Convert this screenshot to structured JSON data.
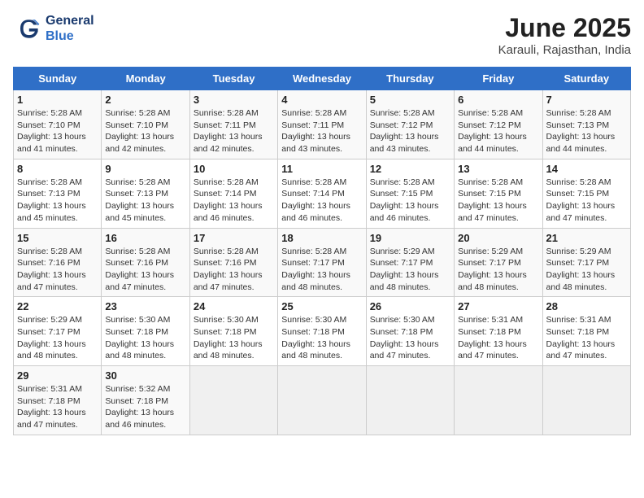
{
  "logo": {
    "line1": "General",
    "line2": "Blue"
  },
  "title": "June 2025",
  "subtitle": "Karauli, Rajasthan, India",
  "days_of_week": [
    "Sunday",
    "Monday",
    "Tuesday",
    "Wednesday",
    "Thursday",
    "Friday",
    "Saturday"
  ],
  "weeks": [
    [
      {
        "day": 1,
        "info": "Sunrise: 5:28 AM\nSunset: 7:10 PM\nDaylight: 13 hours\nand 41 minutes."
      },
      {
        "day": 2,
        "info": "Sunrise: 5:28 AM\nSunset: 7:10 PM\nDaylight: 13 hours\nand 42 minutes."
      },
      {
        "day": 3,
        "info": "Sunrise: 5:28 AM\nSunset: 7:11 PM\nDaylight: 13 hours\nand 42 minutes."
      },
      {
        "day": 4,
        "info": "Sunrise: 5:28 AM\nSunset: 7:11 PM\nDaylight: 13 hours\nand 43 minutes."
      },
      {
        "day": 5,
        "info": "Sunrise: 5:28 AM\nSunset: 7:12 PM\nDaylight: 13 hours\nand 43 minutes."
      },
      {
        "day": 6,
        "info": "Sunrise: 5:28 AM\nSunset: 7:12 PM\nDaylight: 13 hours\nand 44 minutes."
      },
      {
        "day": 7,
        "info": "Sunrise: 5:28 AM\nSunset: 7:13 PM\nDaylight: 13 hours\nand 44 minutes."
      }
    ],
    [
      {
        "day": 8,
        "info": "Sunrise: 5:28 AM\nSunset: 7:13 PM\nDaylight: 13 hours\nand 45 minutes."
      },
      {
        "day": 9,
        "info": "Sunrise: 5:28 AM\nSunset: 7:13 PM\nDaylight: 13 hours\nand 45 minutes."
      },
      {
        "day": 10,
        "info": "Sunrise: 5:28 AM\nSunset: 7:14 PM\nDaylight: 13 hours\nand 46 minutes."
      },
      {
        "day": 11,
        "info": "Sunrise: 5:28 AM\nSunset: 7:14 PM\nDaylight: 13 hours\nand 46 minutes."
      },
      {
        "day": 12,
        "info": "Sunrise: 5:28 AM\nSunset: 7:15 PM\nDaylight: 13 hours\nand 46 minutes."
      },
      {
        "day": 13,
        "info": "Sunrise: 5:28 AM\nSunset: 7:15 PM\nDaylight: 13 hours\nand 47 minutes."
      },
      {
        "day": 14,
        "info": "Sunrise: 5:28 AM\nSunset: 7:15 PM\nDaylight: 13 hours\nand 47 minutes."
      }
    ],
    [
      {
        "day": 15,
        "info": "Sunrise: 5:28 AM\nSunset: 7:16 PM\nDaylight: 13 hours\nand 47 minutes."
      },
      {
        "day": 16,
        "info": "Sunrise: 5:28 AM\nSunset: 7:16 PM\nDaylight: 13 hours\nand 47 minutes."
      },
      {
        "day": 17,
        "info": "Sunrise: 5:28 AM\nSunset: 7:16 PM\nDaylight: 13 hours\nand 47 minutes."
      },
      {
        "day": 18,
        "info": "Sunrise: 5:28 AM\nSunset: 7:17 PM\nDaylight: 13 hours\nand 48 minutes."
      },
      {
        "day": 19,
        "info": "Sunrise: 5:29 AM\nSunset: 7:17 PM\nDaylight: 13 hours\nand 48 minutes."
      },
      {
        "day": 20,
        "info": "Sunrise: 5:29 AM\nSunset: 7:17 PM\nDaylight: 13 hours\nand 48 minutes."
      },
      {
        "day": 21,
        "info": "Sunrise: 5:29 AM\nSunset: 7:17 PM\nDaylight: 13 hours\nand 48 minutes."
      }
    ],
    [
      {
        "day": 22,
        "info": "Sunrise: 5:29 AM\nSunset: 7:17 PM\nDaylight: 13 hours\nand 48 minutes."
      },
      {
        "day": 23,
        "info": "Sunrise: 5:30 AM\nSunset: 7:18 PM\nDaylight: 13 hours\nand 48 minutes."
      },
      {
        "day": 24,
        "info": "Sunrise: 5:30 AM\nSunset: 7:18 PM\nDaylight: 13 hours\nand 48 minutes."
      },
      {
        "day": 25,
        "info": "Sunrise: 5:30 AM\nSunset: 7:18 PM\nDaylight: 13 hours\nand 48 minutes."
      },
      {
        "day": 26,
        "info": "Sunrise: 5:30 AM\nSunset: 7:18 PM\nDaylight: 13 hours\nand 47 minutes."
      },
      {
        "day": 27,
        "info": "Sunrise: 5:31 AM\nSunset: 7:18 PM\nDaylight: 13 hours\nand 47 minutes."
      },
      {
        "day": 28,
        "info": "Sunrise: 5:31 AM\nSunset: 7:18 PM\nDaylight: 13 hours\nand 47 minutes."
      }
    ],
    [
      {
        "day": 29,
        "info": "Sunrise: 5:31 AM\nSunset: 7:18 PM\nDaylight: 13 hours\nand 47 minutes."
      },
      {
        "day": 30,
        "info": "Sunrise: 5:32 AM\nSunset: 7:18 PM\nDaylight: 13 hours\nand 46 minutes."
      },
      null,
      null,
      null,
      null,
      null
    ]
  ],
  "colors": {
    "header_bg": "#2f6fc7",
    "header_text": "#ffffff",
    "logo_dark": "#1a3a6e",
    "logo_blue": "#2f6fc7"
  }
}
